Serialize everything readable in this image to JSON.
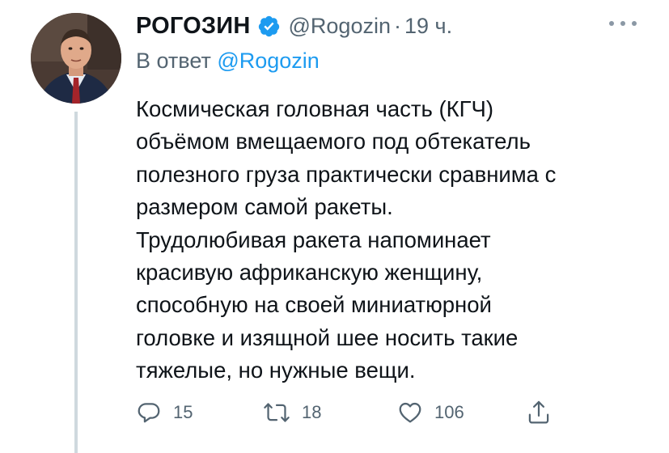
{
  "author": {
    "name": "РОГОЗИН",
    "handle": "@Rogozin",
    "separator": "·",
    "time": "19 ч."
  },
  "reply_to": {
    "prefix": "В ответ",
    "mention": "@Rogozin"
  },
  "text_lines": [
    "Космическая головная часть (КГЧ)",
    "объёмом вмещаемого под обтекатель",
    "полезного груза практически сравнима с",
    "размером самой ракеты.",
    "Трудолюбивая ракета напоминает",
    "красивую африканскую женщину,",
    "способную на своей миниатюрной",
    "головке и изящной шее носить такие",
    "тяжелые, но нужные вещи."
  ],
  "actions": {
    "replies": "15",
    "retweets": "18",
    "likes": "106"
  },
  "colors": {
    "verified": "#1d9bf0",
    "mention": "#1d9bf0",
    "muted": "#536471",
    "thread_line": "#cfd9de"
  },
  "icons": [
    "verified-badge-icon",
    "more-icon",
    "reply-icon",
    "retweet-icon",
    "like-icon",
    "share-icon"
  ]
}
